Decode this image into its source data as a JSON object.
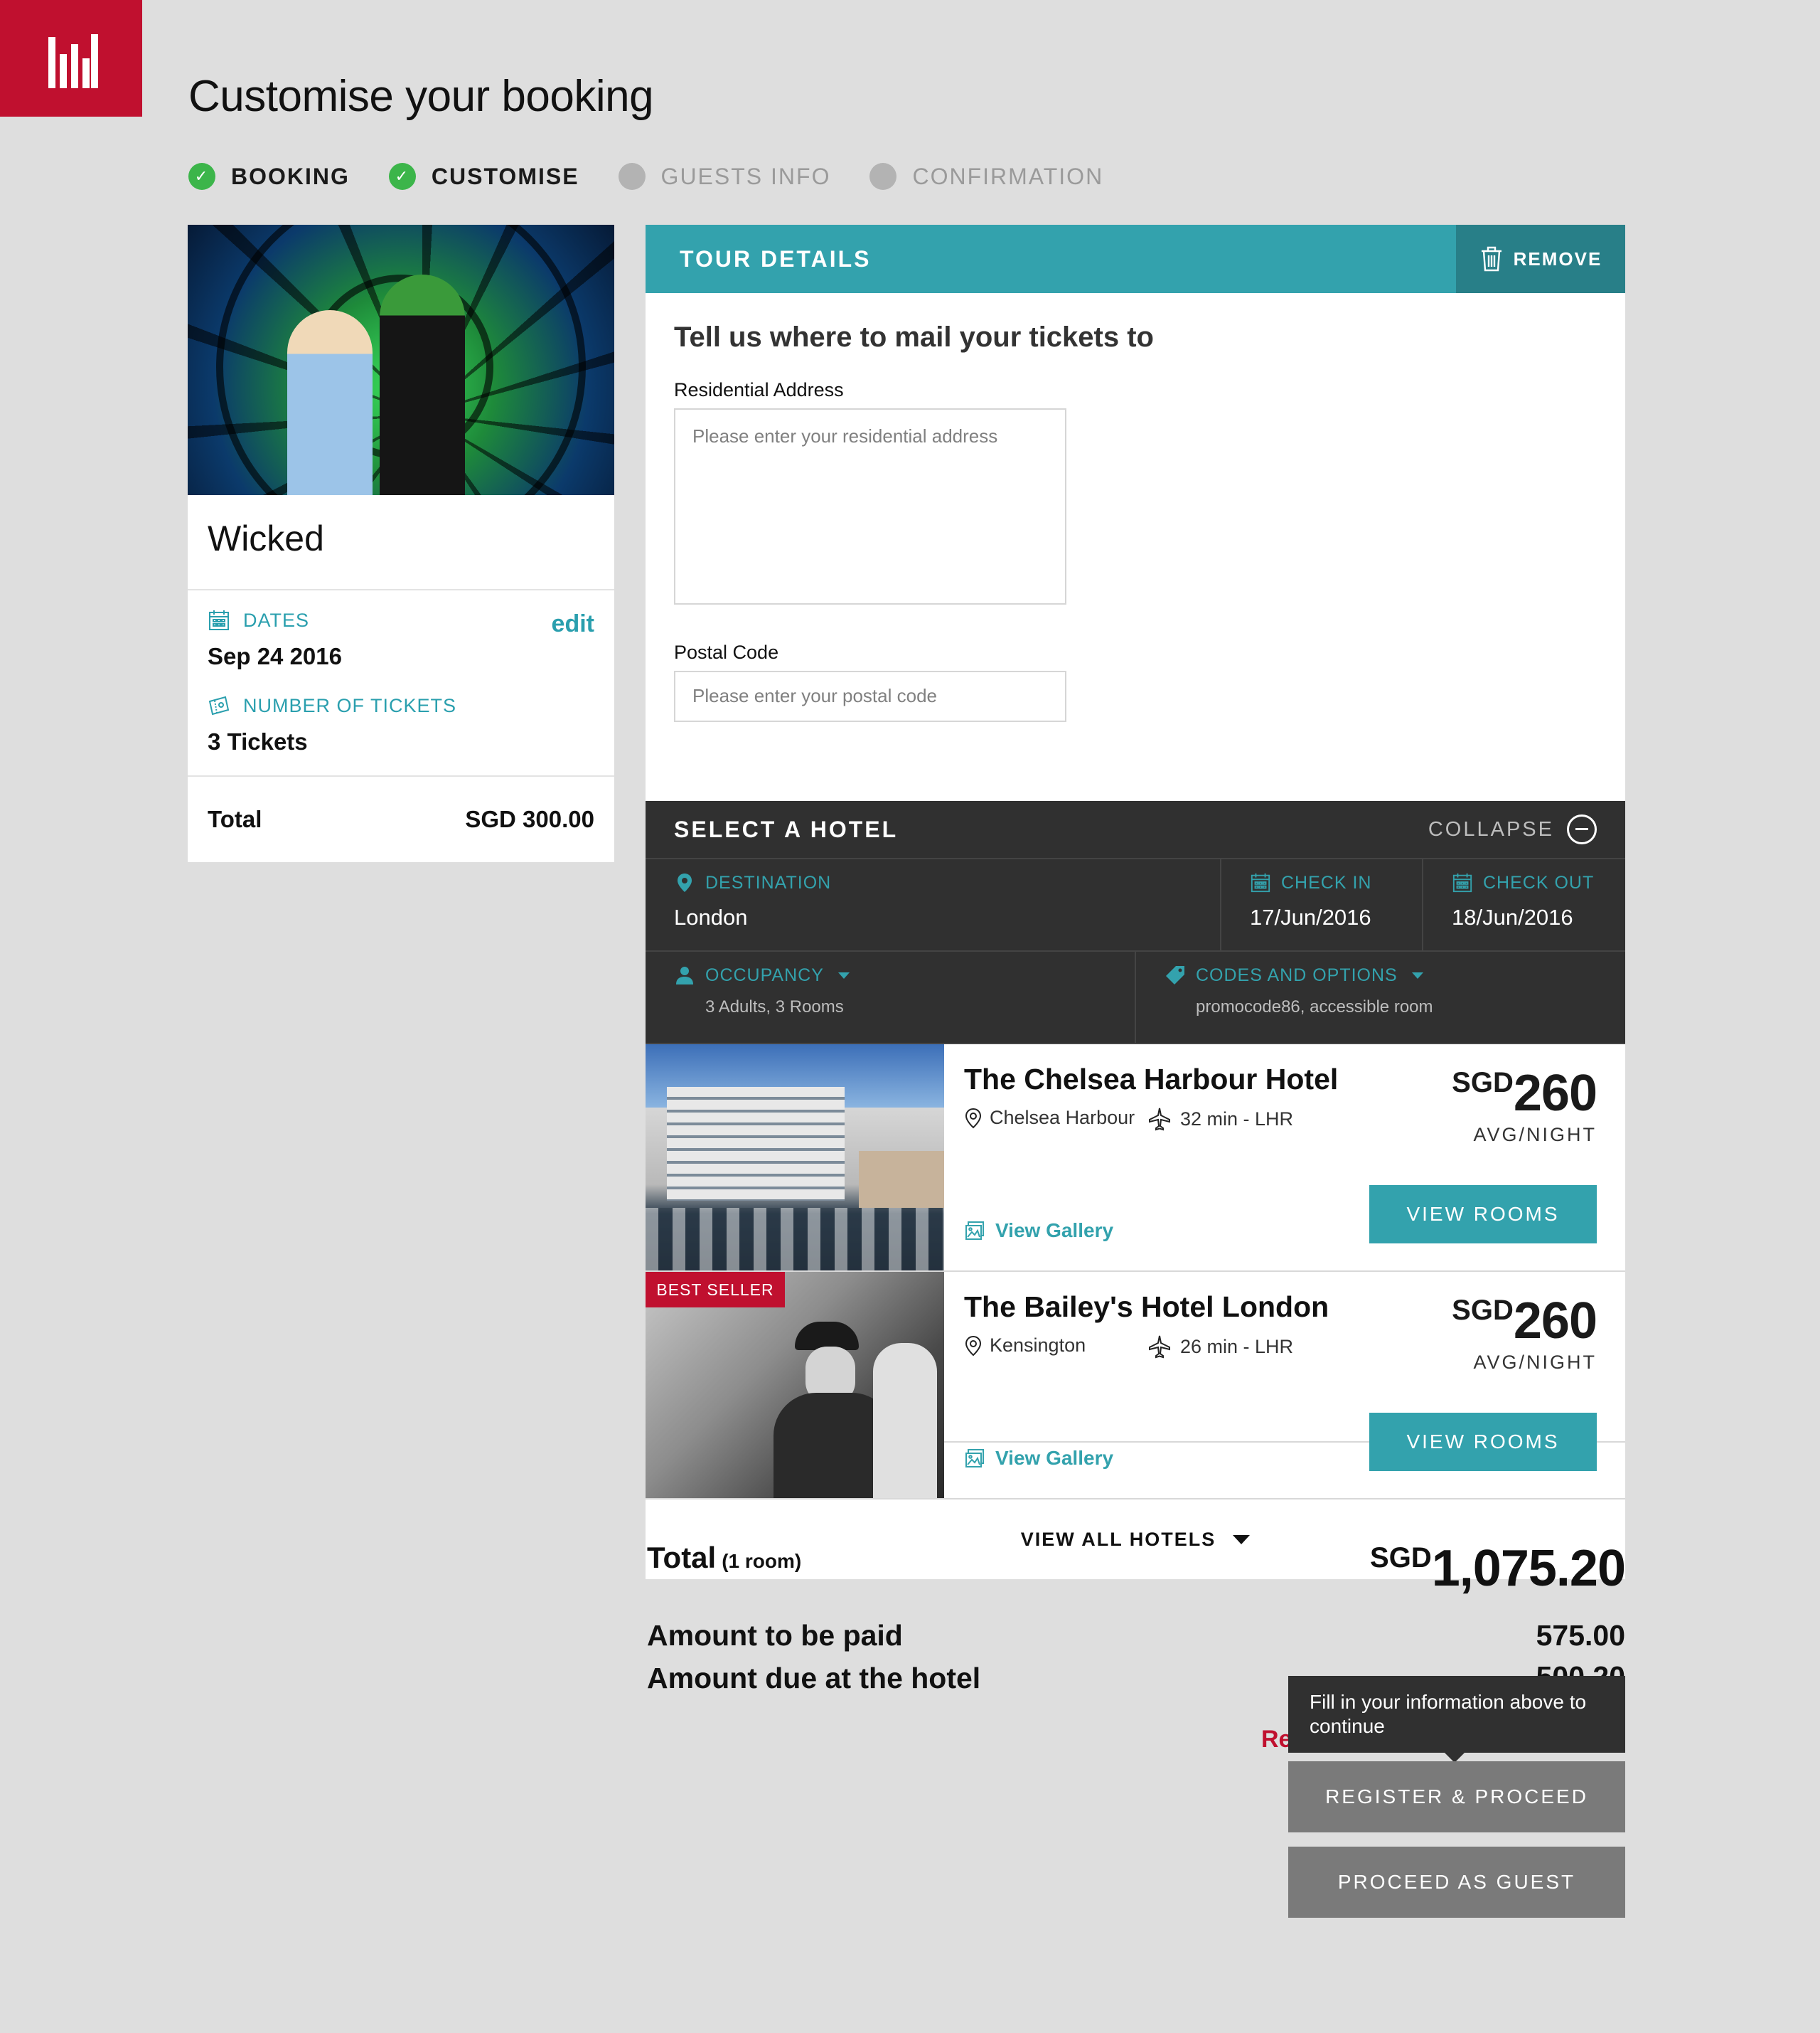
{
  "page": {
    "title": "Customise your booking"
  },
  "steps": [
    {
      "label": "BOOKING",
      "status": "done"
    },
    {
      "label": "CUSTOMISE",
      "status": "done"
    },
    {
      "label": "GUESTS INFO",
      "status": "todo"
    },
    {
      "label": "CONFIRMATION",
      "status": "todo"
    }
  ],
  "summary": {
    "show_title": "Wicked",
    "dates_label": "DATES",
    "edit_label": "edit",
    "date_value": "Sep 24 2016",
    "tickets_label": "NUMBER OF TICKETS",
    "tickets_value": "3 Tickets",
    "total_label": "Total",
    "total_value": "SGD 300.00"
  },
  "tour": {
    "header": "TOUR DETAILS",
    "remove_label": "REMOVE",
    "mail_heading": "Tell us where to mail your tickets to",
    "address_label": "Residential Address",
    "address_placeholder": "Please enter your residential address",
    "postal_label": "Postal Code",
    "postal_placeholder": "Please enter your postal code"
  },
  "hotel_search": {
    "header": "SELECT A HOTEL",
    "collapse_label": "COLLAPSE",
    "destination_label": "DESTINATION",
    "destination_value": "London",
    "checkin_label": "CHECK IN",
    "checkin_value": "17/Jun/2016",
    "checkout_label": "CHECK OUT",
    "checkout_value": "18/Jun/2016",
    "occupancy_label": "OCCUPANCY",
    "occupancy_value": "3 Adults, 3 Rooms",
    "codes_label": "CODES AND OPTIONS",
    "codes_value": "promocode86, accessible room"
  },
  "hotels": [
    {
      "name": "The Chelsea Harbour Hotel",
      "location": "Chelsea Harbour",
      "airport": "32 min - LHR",
      "currency": "SGD",
      "price": "260",
      "per": "AVG/NIGHT",
      "gallery_label": "View Gallery",
      "button_label": "VIEW ROOMS"
    },
    {
      "badge": "BEST SELLER",
      "name": "The Bailey's Hotel London",
      "location": "Kensington",
      "airport": "26 min - LHR",
      "currency": "SGD",
      "price": "260",
      "per": "AVG/NIGHT",
      "gallery_label": "View Gallery",
      "button_label": "VIEW ROOMS"
    }
  ],
  "view_all_label": "VIEW ALL HOTELS",
  "totals": {
    "label": "Total",
    "label_note": "(1 room)",
    "currency": "SGD",
    "amount": "1,075.20",
    "paid_label": "Amount to be paid",
    "paid_value": "575.00",
    "due_label": "Amount due at the hotel",
    "due_value_partial": "500.20",
    "hidden_text": "Re"
  },
  "tooltip_text": "Fill in your information above to continue",
  "register_label": "REGISTER & PROCEED",
  "guest_label": "PROCEED AS GUEST",
  "colors": {
    "brand_red": "#c0102f",
    "teal": "#33a2ad",
    "dark_panel": "#303030",
    "success_green": "#3cb54a",
    "disabled_button": "#7a7a7a"
  }
}
